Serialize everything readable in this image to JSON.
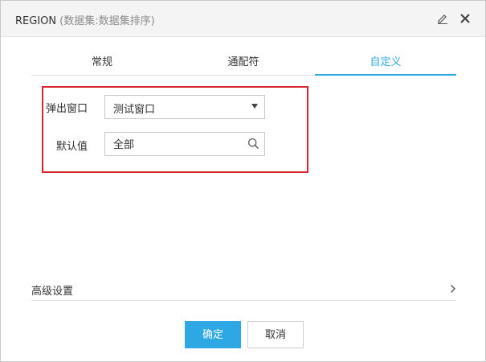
{
  "window": {
    "title": "REGION",
    "subtitle": "(数据集:数据集排序)"
  },
  "icons": {
    "edit": "edit-icon",
    "close": "close-icon",
    "dropdown": "caret-down-icon",
    "search": "search-icon",
    "chevron": "chevron-right-icon"
  },
  "tabs": [
    {
      "label": "常规",
      "active": false
    },
    {
      "label": "通配符",
      "active": false
    },
    {
      "label": "自定义",
      "active": true
    }
  ],
  "form": {
    "popup_label": "弹出窗口",
    "popup_value": "测试窗口",
    "default_label": "默认值",
    "default_value": "全部"
  },
  "advanced": {
    "label": "高级设置"
  },
  "buttons": {
    "ok": "确定",
    "cancel": "取消"
  },
  "colors": {
    "accent": "#2ea8e5",
    "highlight_border": "#d9232e"
  }
}
